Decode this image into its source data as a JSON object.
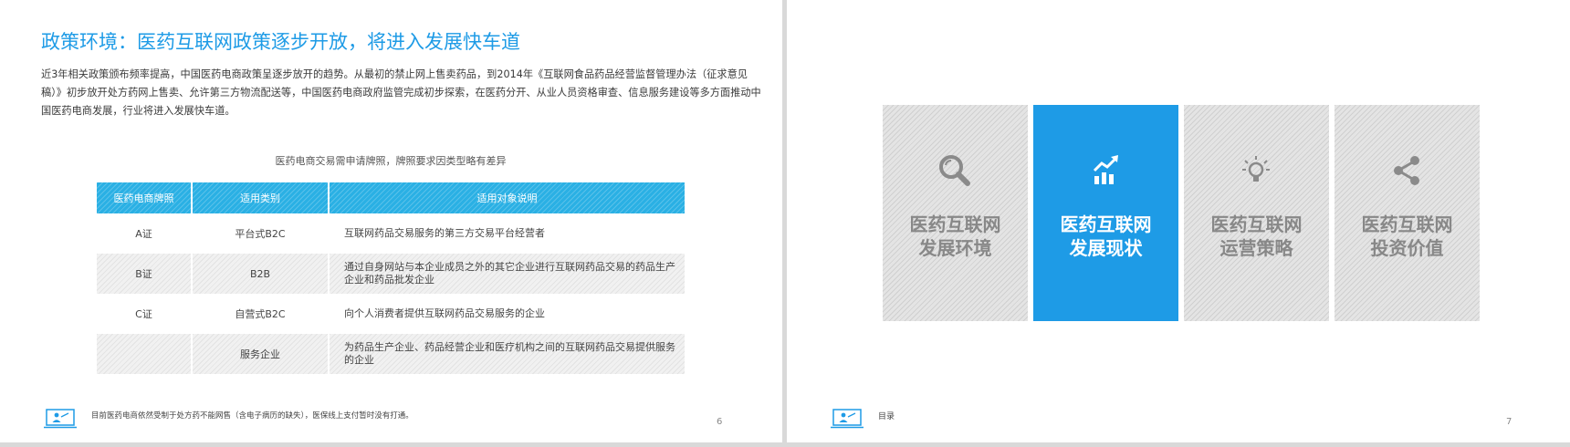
{
  "left_slide": {
    "title": "政策环境：医药互联网政策逐步开放，将进入发展快车道",
    "intro": "近3年相关政策颁布频率提高，中国医药电商政策呈逐步放开的趋势。从最初的禁止网上售卖药品，到2014年《互联网食品药品经营监督管理办法（征求意见稿）》初步放开处方药网上售卖、允许第三方物流配送等，中国医药电商政府监管完成初步探索，在医药分开、从业人员资格审查、信息服务建设等多方面推动中国医药电商发展，行业将进入发展快车道。",
    "table_caption": "医药电商交易需申请牌照，牌照要求因类型略有差异",
    "table": {
      "headers": [
        "医药电商牌照",
        "适用类别",
        "适用对象说明"
      ],
      "rows": [
        {
          "license": "A证",
          "category": "平台式B2C",
          "desc": "互联网药品交易服务的第三方交易平台经营者"
        },
        {
          "license": "B证",
          "category": "B2B",
          "desc": "通过自身网站与本企业成员之外的其它企业进行互联网药品交易的药品生产企业和药品批发企业"
        },
        {
          "license": "C证",
          "category": "自营式B2C",
          "desc": "向个人消费者提供互联网药品交易服务的企业"
        },
        {
          "license": "",
          "category": "服务企业",
          "desc": "为药品生产企业、药品经营企业和医疗机构之间的互联网药品交易提供服务的企业"
        }
      ]
    },
    "footer_note": "目前医药电商依然受制于处方药不能网售（含电子病历的缺失），医保线上支付暂时没有打通。",
    "page_number": "6"
  },
  "right_slide": {
    "tiles": [
      {
        "label_line1": "医药互联网",
        "label_line2": "发展环境",
        "icon": "magnifier-icon",
        "active": false
      },
      {
        "label_line1": "医药互联网",
        "label_line2": "发展现状",
        "icon": "growth-chart-icon",
        "active": true
      },
      {
        "label_line1": "医药互联网",
        "label_line2": "运营策略",
        "icon": "lightbulb-icon",
        "active": false
      },
      {
        "label_line1": "医药互联网",
        "label_line2": "投资价值",
        "icon": "share-icon",
        "active": false
      }
    ],
    "nav_label": "目录",
    "page_number": "7"
  },
  "colors": {
    "accent": "#1e9be6",
    "table_header": "#2ab0e4",
    "tile_inactive_text": "#888888"
  }
}
